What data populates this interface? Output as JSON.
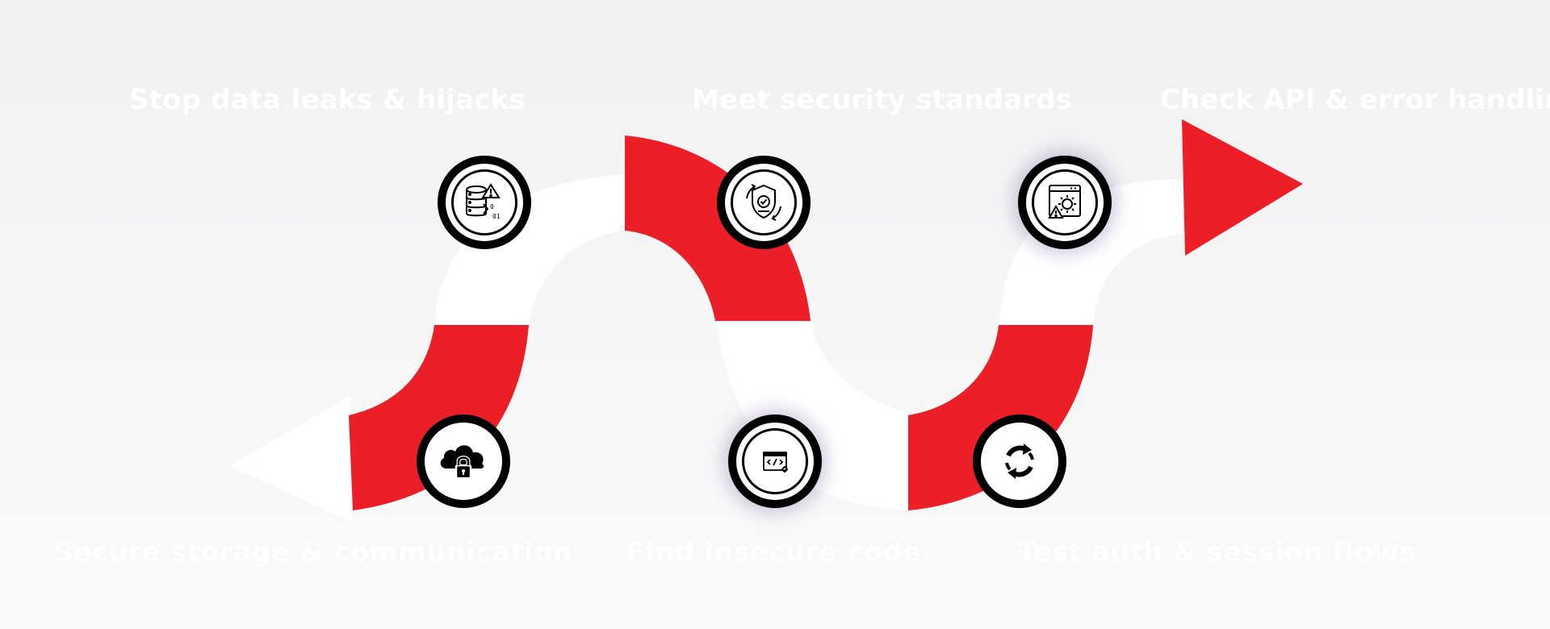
{
  "steps": [
    {
      "label": "Stop data leaks & hijacks",
      "icon": "database-alert-icon"
    },
    {
      "label": "Meet security standards",
      "icon": "shield-check-icon"
    },
    {
      "label": "Check API & error handling",
      "icon": "api-warning-icon"
    },
    {
      "label": "Secure storage & communication",
      "icon": "cloud-lock-icon"
    },
    {
      "label": "Find insecure code",
      "icon": "code-window-icon"
    },
    {
      "label": "Test auth & session flows",
      "icon": "refresh-cycle-icon"
    }
  ],
  "colors": {
    "accent": "#ec1f28",
    "path": "#ffffff",
    "ring": "#000000",
    "background": "#f3f3f4"
  }
}
